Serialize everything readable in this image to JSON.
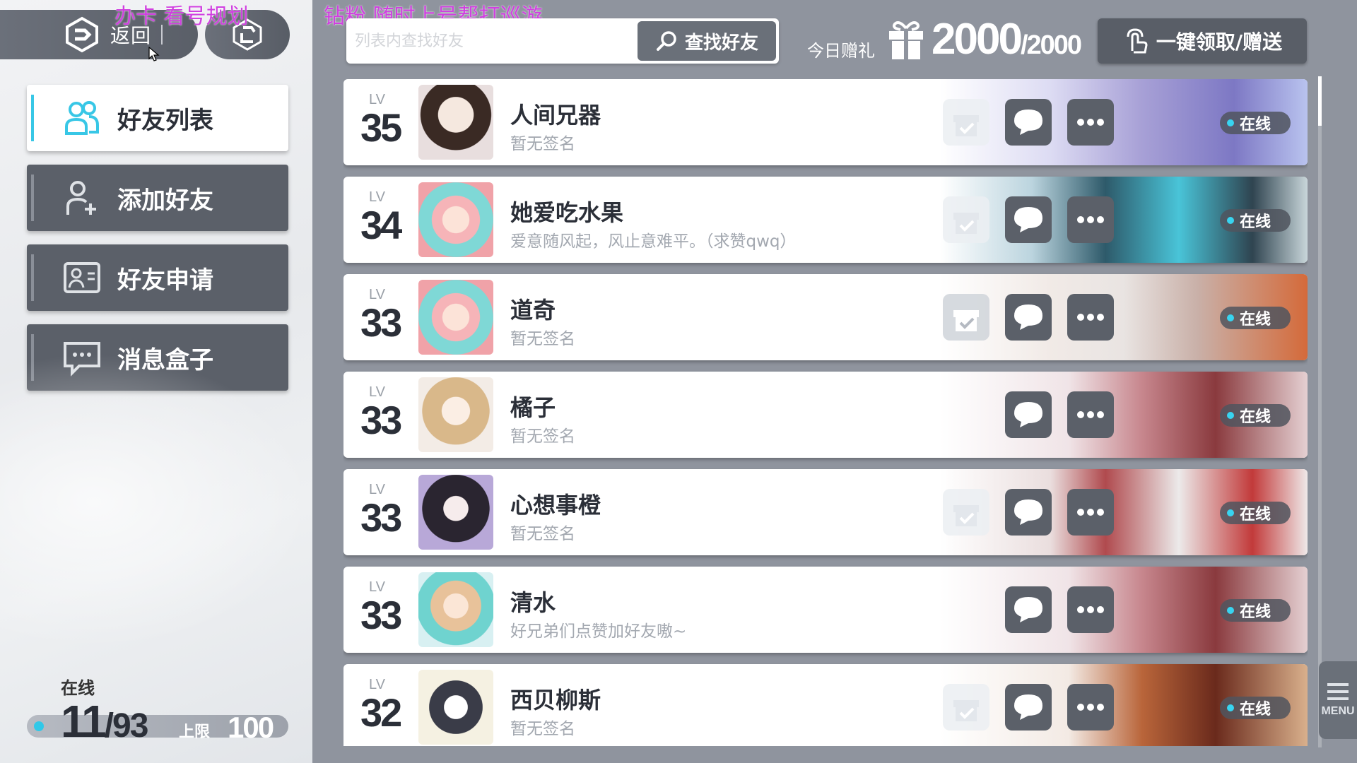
{
  "top": {
    "back_label": "返回",
    "overlay_left": "办卡 看号规划",
    "overlay_right": "钻粉 随时上号帮打巡游"
  },
  "menu": [
    {
      "label": "好友列表",
      "icon": "friends-icon",
      "active": true
    },
    {
      "label": "添加好友",
      "icon": "add-friend-icon",
      "active": false
    },
    {
      "label": "好友申请",
      "icon": "friend-request-icon",
      "active": false
    },
    {
      "label": "消息盒子",
      "icon": "message-box-icon",
      "active": false
    }
  ],
  "online": {
    "label": "在线",
    "count": "11",
    "total": "/93",
    "limit_label": "上限",
    "limit_value": "100"
  },
  "search": {
    "placeholder": "列表内查找好友",
    "button_label": "查找好友"
  },
  "gift": {
    "label": "今日赠礼",
    "current": "2000",
    "max": "/2000"
  },
  "claim_button": "一键领取/赠送",
  "status_online": "在线",
  "friends": [
    {
      "lv_label": "LV",
      "level": "35",
      "name": "人间兄器",
      "signature": "暂无签名",
      "gift_available": true
    },
    {
      "lv_label": "LV",
      "level": "34",
      "name": "她爱吃水果",
      "signature": "爱意随风起，风止意难平。（求赞qwq）",
      "gift_available": true
    },
    {
      "lv_label": "LV",
      "level": "33",
      "name": "道奇",
      "signature": "暂无签名",
      "gift_available": true
    },
    {
      "lv_label": "LV",
      "level": "33",
      "name": "橘子",
      "signature": "暂无签名",
      "gift_available": false
    },
    {
      "lv_label": "LV",
      "level": "33",
      "name": "心想事橙",
      "signature": "暂无签名",
      "gift_available": true
    },
    {
      "lv_label": "LV",
      "level": "33",
      "name": "清水",
      "signature": "好兄弟们点赞加好友嗷~",
      "gift_available": false
    },
    {
      "lv_label": "LV",
      "level": "32",
      "name": "西贝柳斯",
      "signature": "暂无签名",
      "gift_available": true
    }
  ],
  "side_menu_label": "MENU",
  "colors": {
    "accent": "#38c7e6",
    "panel_dark": "#5b6069",
    "overlay_text": "#d040e0"
  }
}
